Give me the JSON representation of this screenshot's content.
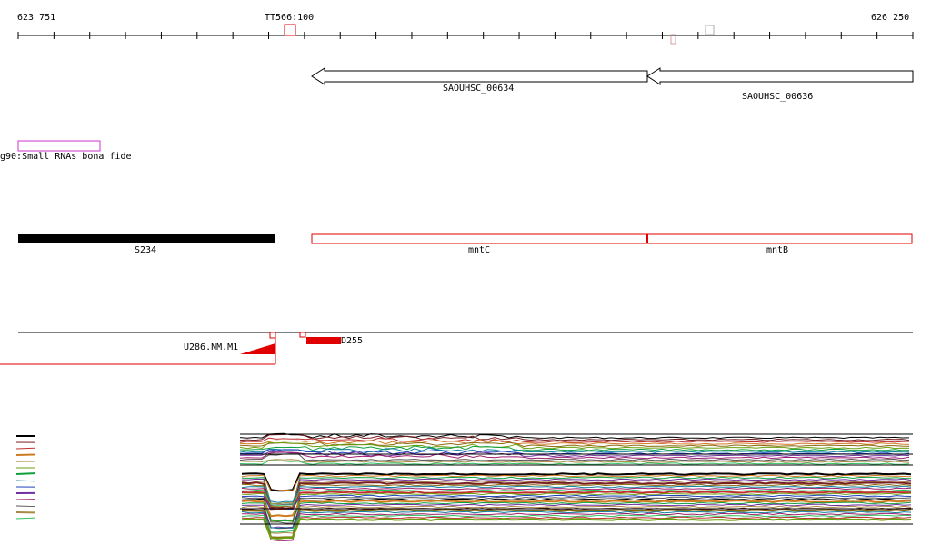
{
  "ruler": {
    "start_label": "623 751",
    "end_label": "626 250",
    "marker_label": "TT566:100"
  },
  "genes": {
    "left": {
      "name": "SAOUHSC_00634"
    },
    "right": {
      "name": "SAOUHSC_00636"
    }
  },
  "track_small_rna": {
    "label": "g90:Small RNAs bona fide"
  },
  "track_features": {
    "items": [
      {
        "name": "S234",
        "color": "#000000",
        "style": "filled"
      },
      {
        "name": "mntC",
        "color": "#e00000",
        "style": "outline"
      },
      {
        "name": "mntB",
        "color": "#e00000",
        "style": "outline"
      }
    ]
  },
  "track_utr": {
    "left_label": "U286.NM.M1",
    "right_label": "D255",
    "accent": "#e00000"
  },
  "colors": {
    "black": "#000000",
    "red": "#e00000",
    "magenta": "#cc33cc"
  }
}
